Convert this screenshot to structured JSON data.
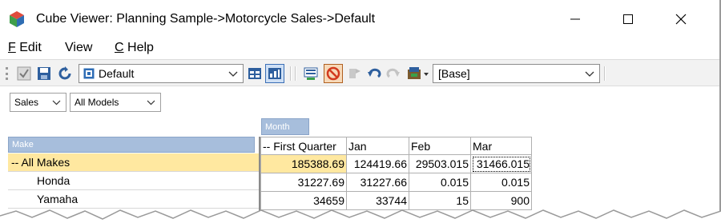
{
  "window": {
    "title": "Cube Viewer: Planning Sample->Motorcycle Sales->Default",
    "controls": {
      "minimize": "minimize",
      "maximize": "maximize",
      "close": "close"
    }
  },
  "menu": {
    "items": [
      {
        "key": "F",
        "label": "Edit"
      },
      {
        "key": "",
        "label": "View"
      },
      {
        "key": "C",
        "label": "Help"
      }
    ]
  },
  "toolbar": {
    "view_combo": "Default",
    "base_combo": "[Base]"
  },
  "filters": [
    {
      "value": "Sales"
    },
    {
      "value": "All Models"
    }
  ],
  "grid": {
    "column_dimension": "Month",
    "row_dimension": "Make",
    "columns": [
      "-- First Quarter",
      "Jan",
      "Feb",
      "Mar"
    ],
    "rows": [
      {
        "label": "-- All Makes",
        "values": [
          "185388.69",
          "124419.66",
          "29503.015",
          "31466.015"
        ]
      },
      {
        "label": "Honda",
        "values": [
          "31227.69",
          "31227.66",
          "0.015",
          "0.015"
        ]
      },
      {
        "label": "Yamaha",
        "values": [
          "34659",
          "33744",
          "15",
          "900"
        ]
      }
    ]
  },
  "colors": {
    "header_blue": "#a7bedc",
    "all_row": "#ffe8a0",
    "selected_header": "#ffffc6"
  }
}
